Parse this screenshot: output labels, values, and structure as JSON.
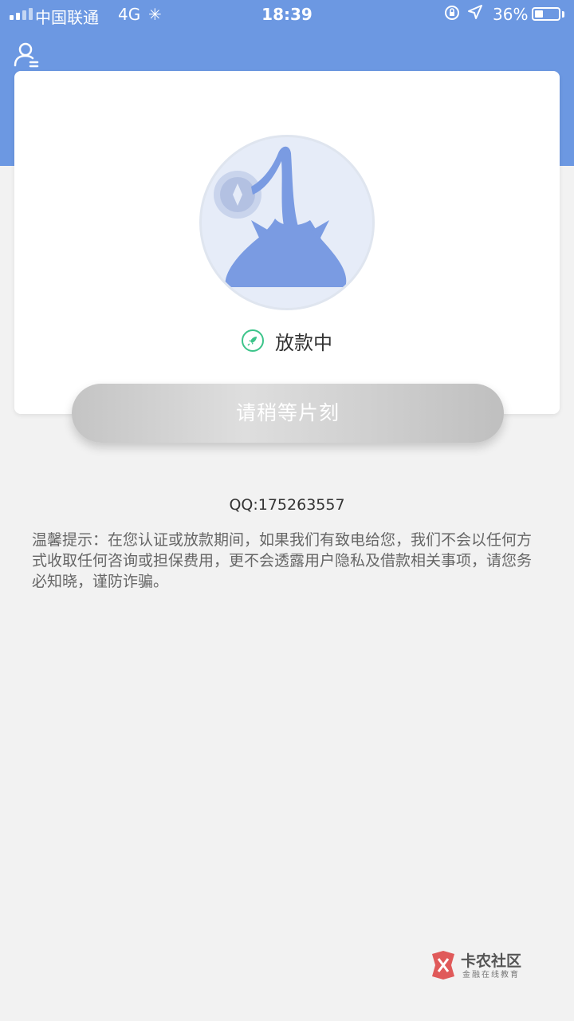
{
  "status_bar": {
    "carrier": "中国联通",
    "network": "4G",
    "time": "18:39",
    "battery": "36%",
    "battery_level": 0.36
  },
  "card": {
    "status_text": "放款中"
  },
  "wait_button": {
    "label": "请稍等片刻"
  },
  "contact": {
    "qq": "QQ:175263557"
  },
  "notice": {
    "text": "温馨提示：在您认证或放款期间，如果我们有致电给您，我们不会以任何方式收取任何咨询或担保费用，更不会透露用户隐私及借款相关事项，请您务必知晓，谨防诈骗。"
  },
  "watermark": {
    "title": "卡农社区",
    "subtitle": "金融在线教育"
  },
  "colors": {
    "header": "#6c98e2",
    "accent_green": "#3cc48a",
    "illustration": "#7a9be2"
  }
}
